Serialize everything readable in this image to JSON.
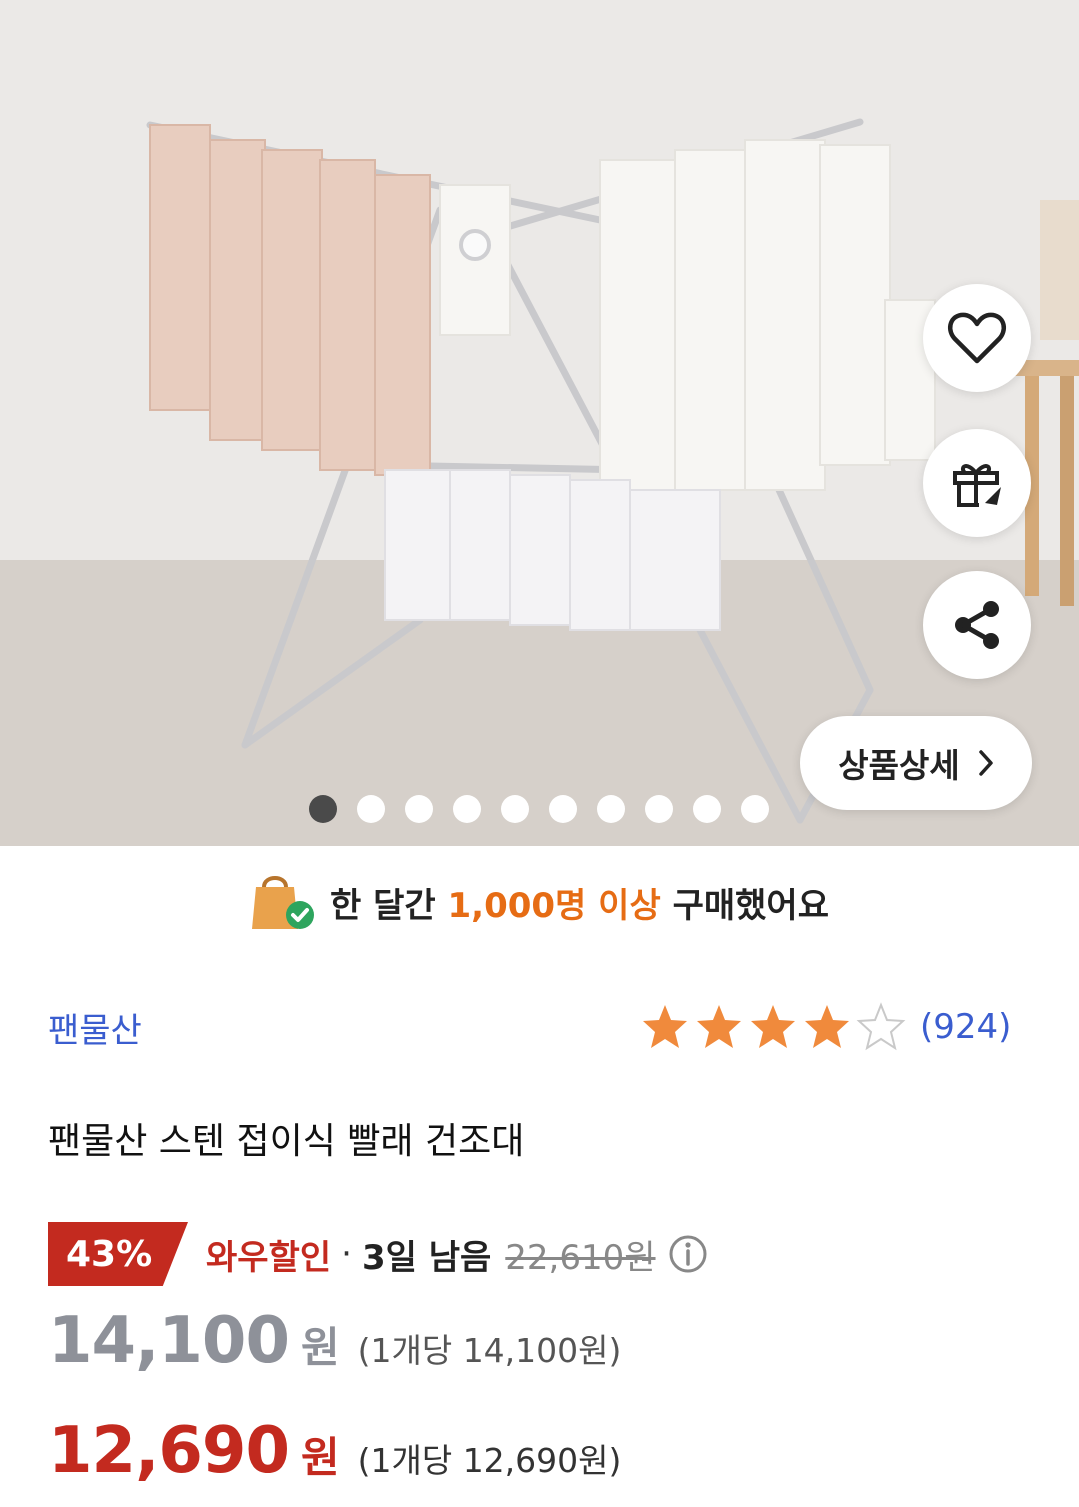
{
  "hero": {
    "active_slide": 1,
    "slide_count": 10,
    "detail_button_label": "상품상세",
    "side_icons": [
      "heart-icon",
      "gift-icon",
      "share-icon"
    ]
  },
  "banner": {
    "prefix": "한 달간",
    "highlight": "1,000명 이상",
    "suffix": "구매했어요",
    "accent_color": "#e66c14"
  },
  "product": {
    "seller": "팬물산",
    "rating_stars": 4,
    "rating_max": 5,
    "review_count": "(924)",
    "title": "팬물산 스텐 접이식 빨래 건조대"
  },
  "discount": {
    "percent": "43%",
    "label": "와우할인",
    "separator": "·",
    "time_left": "3일 남음",
    "original_price": "22,610원",
    "accent_color": "#c32a1f"
  },
  "prices": {
    "regular": {
      "amount": "14,100",
      "currency": "원",
      "unit_price": "(1개당 14,100원)"
    },
    "wow": {
      "amount": "12,690",
      "currency": "원",
      "unit_price": "(1개당 12,690원)"
    }
  }
}
